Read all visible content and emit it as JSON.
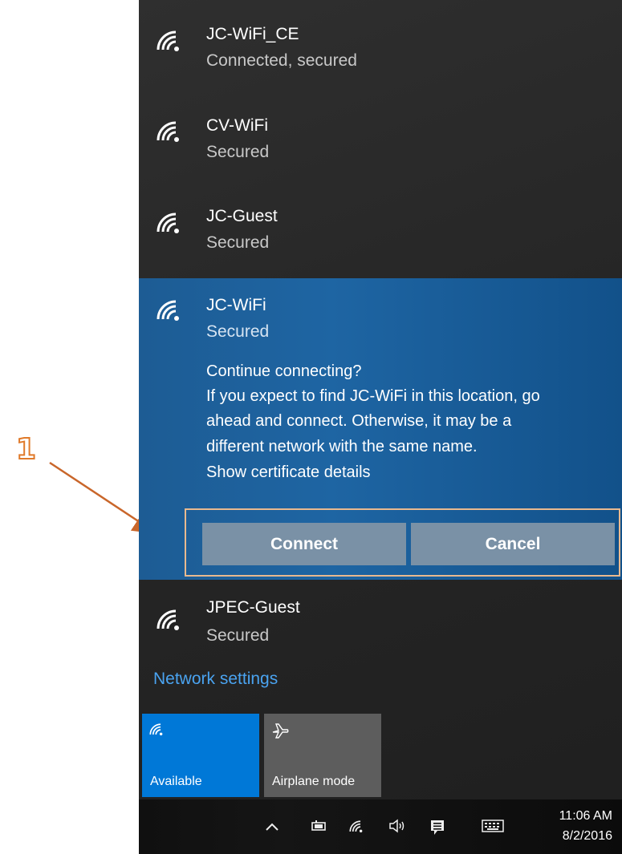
{
  "networks": [
    {
      "name": "JC-WiFi_CE",
      "status": "Connected, secured"
    },
    {
      "name": "CV-WiFi",
      "status": "Secured"
    },
    {
      "name": "JC-Guest",
      "status": "Secured"
    }
  ],
  "selected_network": {
    "name": "JC-WiFi",
    "status": "Secured",
    "prompt_title": "Continue connecting?",
    "prompt_lines": [
      "If you expect to find JC-WiFi in this location, go",
      "ahead and connect. Otherwise, it may be a",
      "different network with the same name."
    ],
    "certificate_link": "Show certificate details",
    "connect_label": "Connect",
    "cancel_label": "Cancel"
  },
  "network_after": {
    "name": "JPEC-Guest",
    "status": "Secured"
  },
  "network_settings_label": "Network settings",
  "quick_actions": [
    {
      "label": "Available",
      "icon": "wifi-icon",
      "active": true
    },
    {
      "label": "Airplane mode",
      "icon": "airplane-icon",
      "active": false
    }
  ],
  "taskbar": {
    "time": "11:06 AM",
    "date": "8/2/2016",
    "tray_icons": [
      "chevron-up-icon",
      "battery-icon",
      "wifi-icon",
      "volume-icon",
      "action-center-icon",
      "keyboard-icon"
    ]
  },
  "annotation": {
    "number": "1"
  },
  "colors": {
    "accent_blue": "#0078d7",
    "link_blue": "#4aa3f0",
    "annotation_orange": "#e07a2a"
  }
}
